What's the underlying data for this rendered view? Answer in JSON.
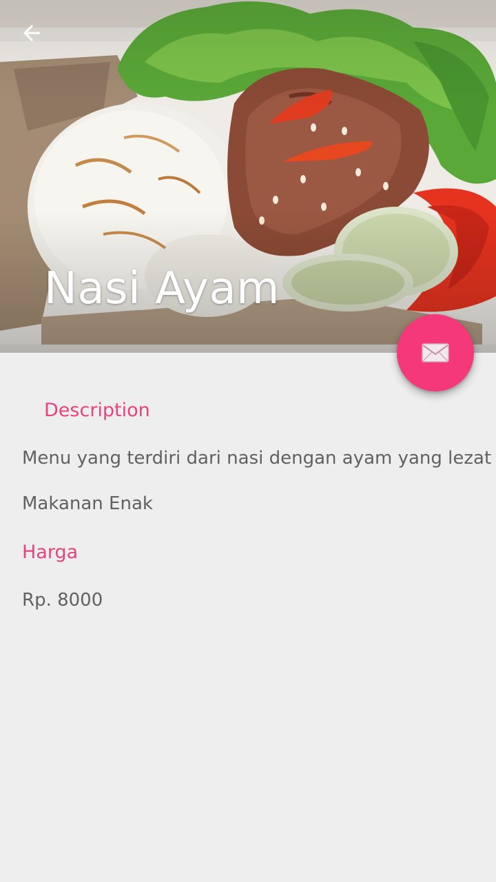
{
  "header": {
    "title": "Nasi Ayam",
    "back_icon": "arrow-left-icon",
    "image": "food-photo"
  },
  "fab": {
    "icon": "envelope-icon",
    "color": "#f5387a"
  },
  "details": {
    "description_heading": "Description",
    "description_text": "Menu yang terdiri dari nasi dengan ayam yang lezat",
    "category_text": "Makanan Enak",
    "price_heading": "Harga",
    "price_text": "Rp. 8000"
  },
  "colors": {
    "accent": "#e8417d",
    "background": "#eeeeee",
    "text": "#616161"
  }
}
